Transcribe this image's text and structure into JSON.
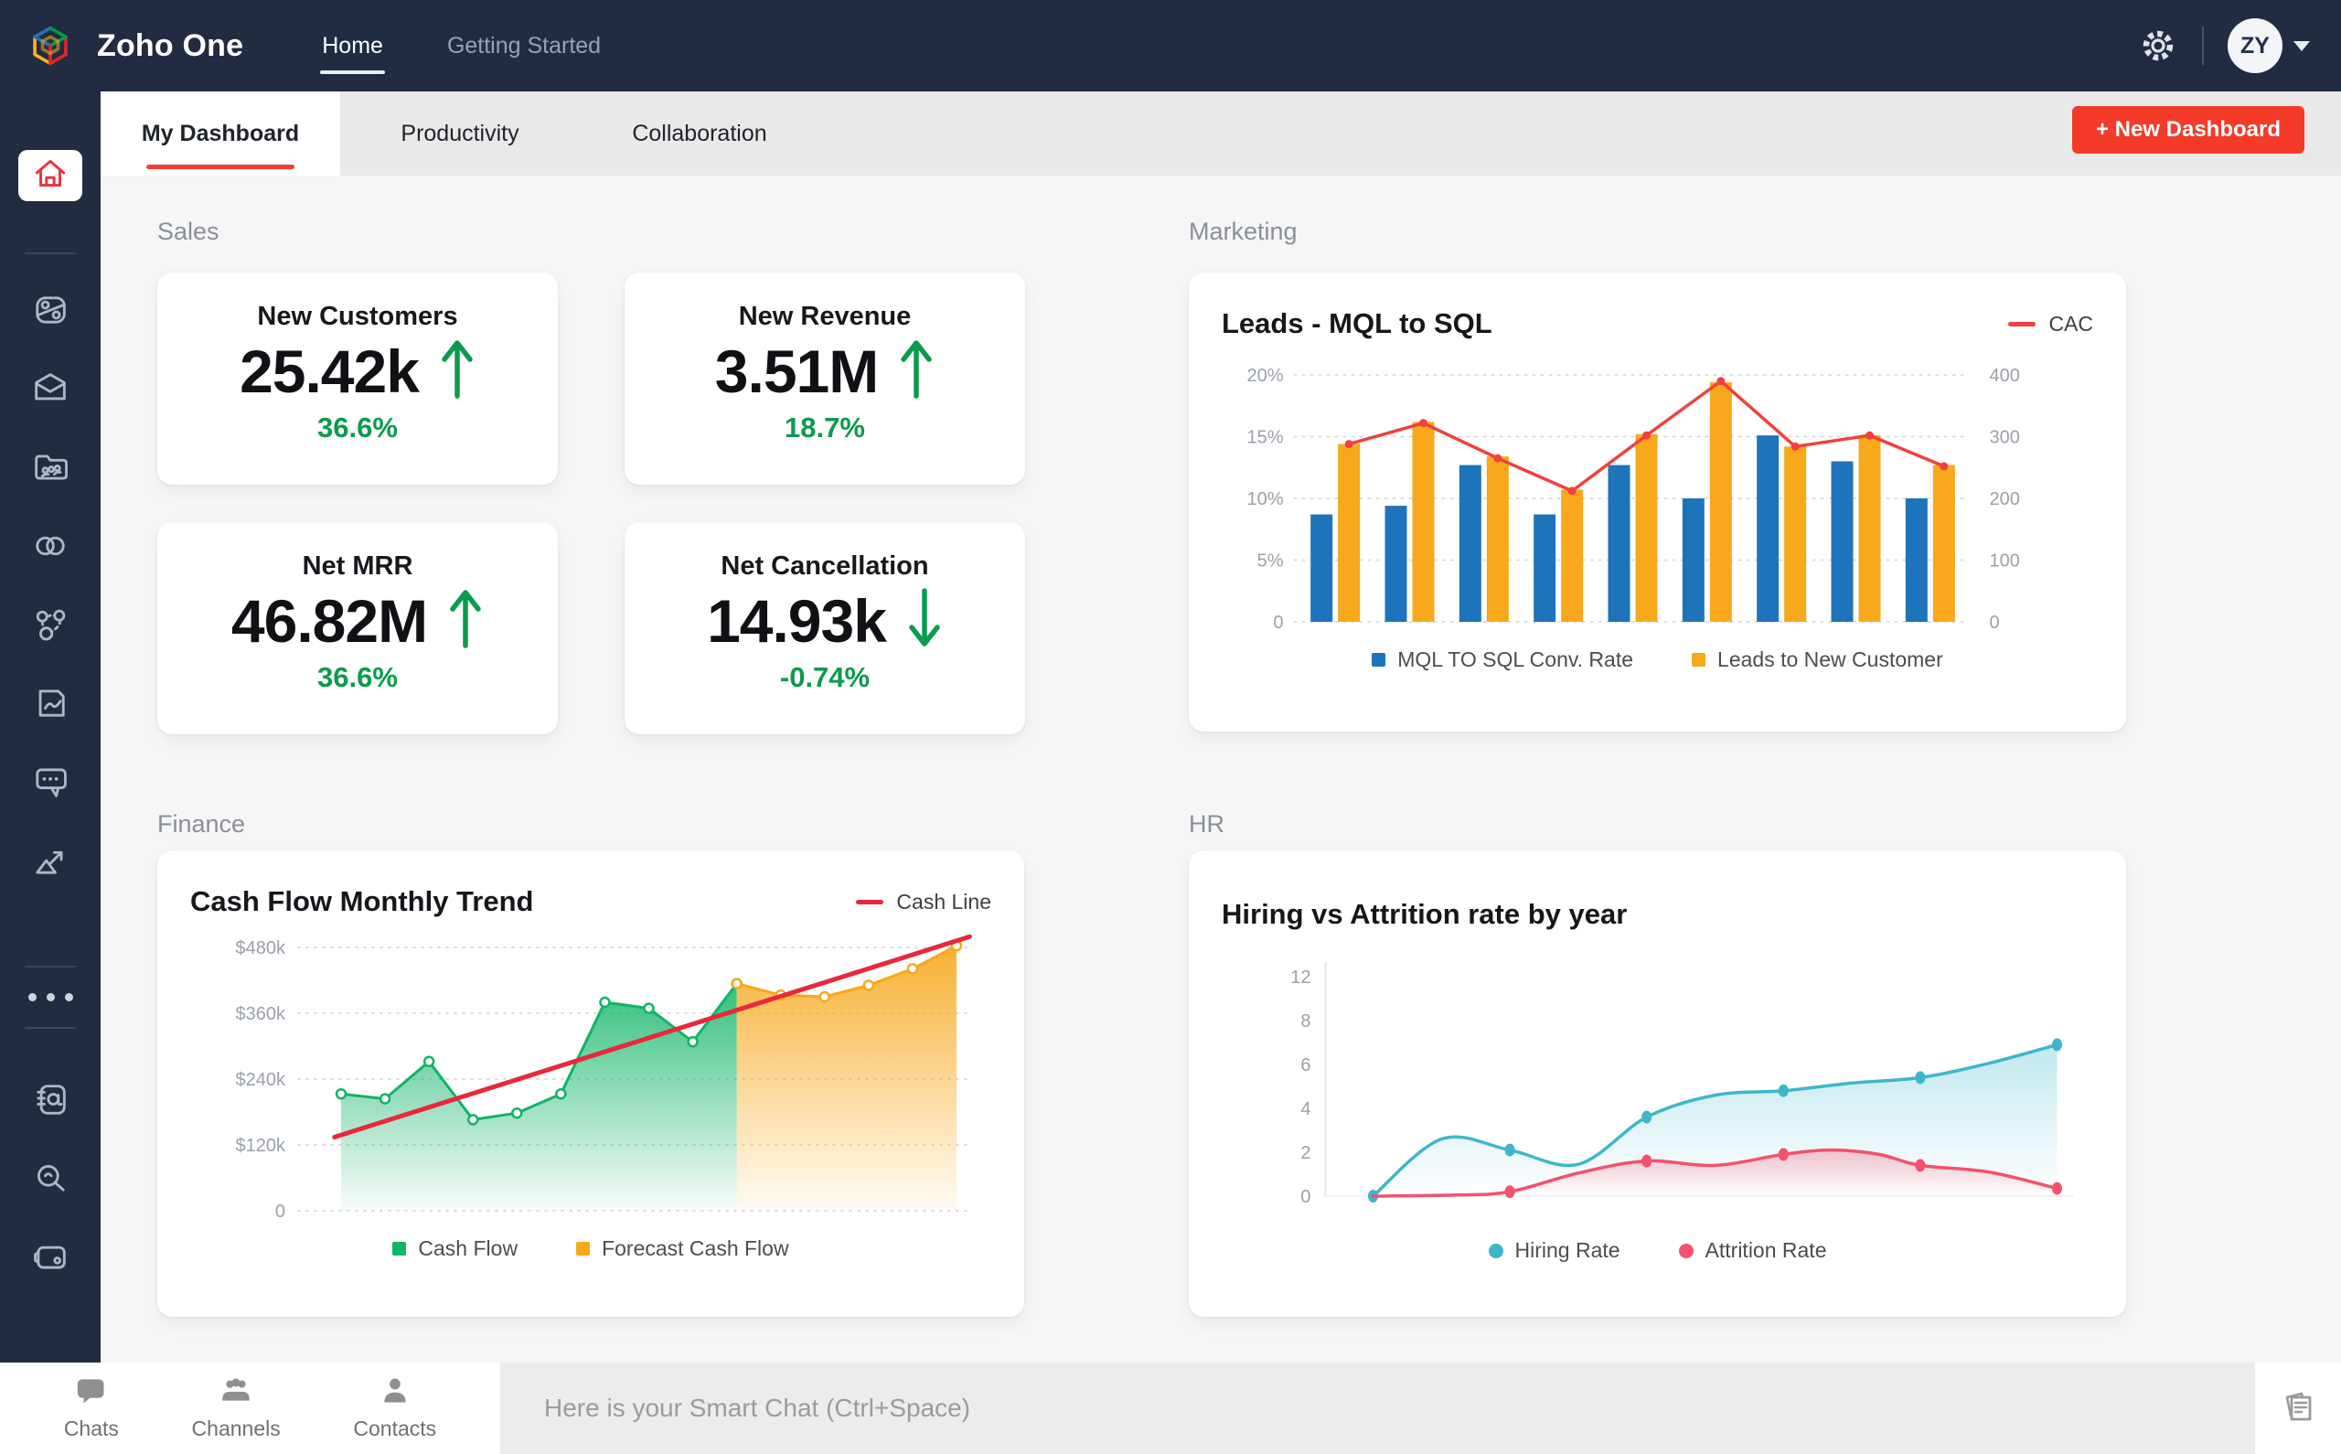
{
  "topbar": {
    "brand": "Zoho One",
    "nav": [
      {
        "label": "Home",
        "active": true
      },
      {
        "label": "Getting Started",
        "active": false
      }
    ],
    "avatar_initials": "ZY"
  },
  "tabs": {
    "items": [
      {
        "label": "My Dashboard",
        "active": true
      },
      {
        "label": "Productivity",
        "active": false
      },
      {
        "label": "Collaboration",
        "active": false
      }
    ],
    "new_dashboard": "+ New Dashboard"
  },
  "sections": {
    "sales": "Sales",
    "marketing": "Marketing",
    "finance": "Finance",
    "hr": "HR"
  },
  "kpis": [
    {
      "title": "New Customers",
      "value": "25.42k",
      "direction": "up",
      "delta": "36.6%"
    },
    {
      "title": "New Revenue",
      "value": "3.51M",
      "direction": "up",
      "delta": "18.7%"
    },
    {
      "title": "Net MRR",
      "value": "46.82M",
      "direction": "up",
      "delta": "36.6%"
    },
    {
      "title": "Net Cancellation",
      "value": "14.93k",
      "direction": "down",
      "delta": "-0.74%"
    }
  ],
  "sidebar": {
    "active": "home",
    "icons": [
      "home",
      "crm",
      "mail",
      "workdrive",
      "flow",
      "connections",
      "sign",
      "cliq-chat",
      "analytics",
      "more-options",
      "books",
      "search",
      "wallet"
    ]
  },
  "bottom_bar": {
    "tabs": [
      {
        "label": "Chats"
      },
      {
        "label": "Channels"
      },
      {
        "label": "Contacts"
      }
    ],
    "smart_chat_placeholder": "Here is your Smart Chat (Ctrl+Space)"
  },
  "colors": {
    "topbar_bg": "#212c42",
    "accent_red": "#f43b2a",
    "kpi_green": "#0a9b4c",
    "bar_blue": "#1e74bb",
    "bar_orange": "#f7a81b",
    "line_red": "#f0413e",
    "area_green": "#10b467",
    "trend_red": "#e8283b",
    "hiring_teal": "#3db6cb",
    "attrition_pink": "#f4516c"
  },
  "chart_data": [
    {
      "id": "marketing",
      "type": "bar+line",
      "title": "Leads - MQL to SQL",
      "categories": [
        "",
        "",
        "",
        "",
        "",
        "",
        "",
        "",
        ""
      ],
      "left_axis": {
        "min": 0,
        "max": 20,
        "ticks": [
          0,
          5,
          10,
          15,
          20
        ],
        "tick_labels": [
          "0",
          "5%",
          "10%",
          "15%",
          "20%"
        ]
      },
      "right_axis": {
        "min": 0,
        "max": 400,
        "ticks": [
          0,
          100,
          200,
          300,
          400
        ],
        "tick_labels": [
          "0",
          "100",
          "200",
          "300",
          "400"
        ]
      },
      "grid": "dotted-horizontal",
      "series": [
        {
          "name": "MQL TO SQL Conv. Rate",
          "type": "bar",
          "axis": "left",
          "color": "#1e74bb",
          "values": [
            8.7,
            9.4,
            12.7,
            8.7,
            12.7,
            10,
            15.1,
            13,
            10
          ]
        },
        {
          "name": "Leads to New Customer",
          "type": "bar",
          "axis": "left",
          "color": "#f7a81b",
          "values": [
            14.4,
            16.2,
            13.4,
            10.7,
            15.2,
            19.4,
            14.2,
            15.1,
            12.7
          ]
        },
        {
          "name": "CAC",
          "type": "line",
          "axis": "right",
          "color": "#f0413e",
          "values": [
            288,
            322,
            265,
            212,
            302,
            390,
            284,
            302,
            252
          ]
        }
      ],
      "legend": {
        "top_right": [
          "CAC"
        ],
        "bottom": [
          "MQL TO SQL Conv. Rate",
          "Leads to New Customer"
        ]
      }
    },
    {
      "id": "finance",
      "type": "area+line",
      "title": "Cash Flow Monthly Trend",
      "y_axis": {
        "min": 0,
        "max": 520,
        "ticks": [
          480,
          360,
          240,
          120,
          0
        ],
        "tick_labels": [
          "$480k",
          "$360k",
          "$240k",
          "$120k",
          "0"
        ]
      },
      "x_range": [
        0,
        14
      ],
      "series": [
        {
          "name": "Cash Flow",
          "type": "area",
          "color": "#10b467",
          "x": [
            0,
            1,
            2,
            3,
            4,
            5,
            6,
            7,
            8,
            9
          ],
          "values": [
            213,
            204,
            272,
            166,
            178,
            213,
            380,
            369,
            308,
            414
          ]
        },
        {
          "name": "Forecast Cash Flow",
          "type": "area",
          "color": "#f7a81b",
          "x": [
            9,
            10,
            11,
            12,
            13,
            14
          ],
          "values": [
            414,
            393,
            390,
            411,
            441,
            483
          ]
        },
        {
          "name": "Cash Line",
          "type": "trendline",
          "color": "#e8283b",
          "from": [
            0,
            138
          ],
          "to": [
            14,
            492
          ]
        }
      ],
      "legend": {
        "top_right": [
          "Cash Line"
        ],
        "bottom": [
          "Cash Flow",
          "Forecast Cash Flow"
        ]
      }
    },
    {
      "id": "hr",
      "type": "smooth-line",
      "title": "Hiring vs Attrition rate by year",
      "y_axis": {
        "tick_values": [
          12,
          8,
          6,
          4,
          2,
          0
        ],
        "tick_labels": [
          "12",
          "8",
          "6",
          "4",
          "2",
          "0"
        ]
      },
      "x_range": [
        0,
        5
      ],
      "series": [
        {
          "name": "Hiring Rate",
          "color": "#3db6cb",
          "curve": [
            [
              0,
              0
            ],
            [
              0.5,
              2.6
            ],
            [
              1,
              2.1
            ],
            [
              1.5,
              1.45
            ],
            [
              2,
              3.6
            ],
            [
              2.5,
              4.6
            ],
            [
              3,
              4.8
            ],
            [
              3.5,
              5.15
            ],
            [
              4,
              5.4
            ],
            [
              4.5,
              6.05
            ],
            [
              5,
              6.9
            ]
          ],
          "markers": [
            [
              0,
              0
            ],
            [
              1,
              2.1
            ],
            [
              2,
              3.6
            ],
            [
              3,
              4.8
            ],
            [
              4,
              5.4
            ],
            [
              5,
              6.9
            ]
          ]
        },
        {
          "name": "Attrition Rate",
          "color": "#f4516c",
          "curve": [
            [
              0,
              0
            ],
            [
              0.6,
              0.05
            ],
            [
              1,
              0.2
            ],
            [
              1.5,
              1.05
            ],
            [
              2,
              1.6
            ],
            [
              2.5,
              1.4
            ],
            [
              3,
              1.9
            ],
            [
              3.35,
              2.1
            ],
            [
              3.7,
              1.9
            ],
            [
              4,
              1.4
            ],
            [
              4.5,
              1.1
            ],
            [
              5,
              0.35
            ]
          ],
          "markers": [
            [
              1,
              0.2
            ],
            [
              2,
              1.6
            ],
            [
              3,
              1.9
            ],
            [
              4,
              1.4
            ],
            [
              5,
              0.35
            ]
          ]
        }
      ],
      "legend": {
        "bottom": [
          "Hiring Rate",
          "Attrition Rate"
        ]
      }
    }
  ]
}
